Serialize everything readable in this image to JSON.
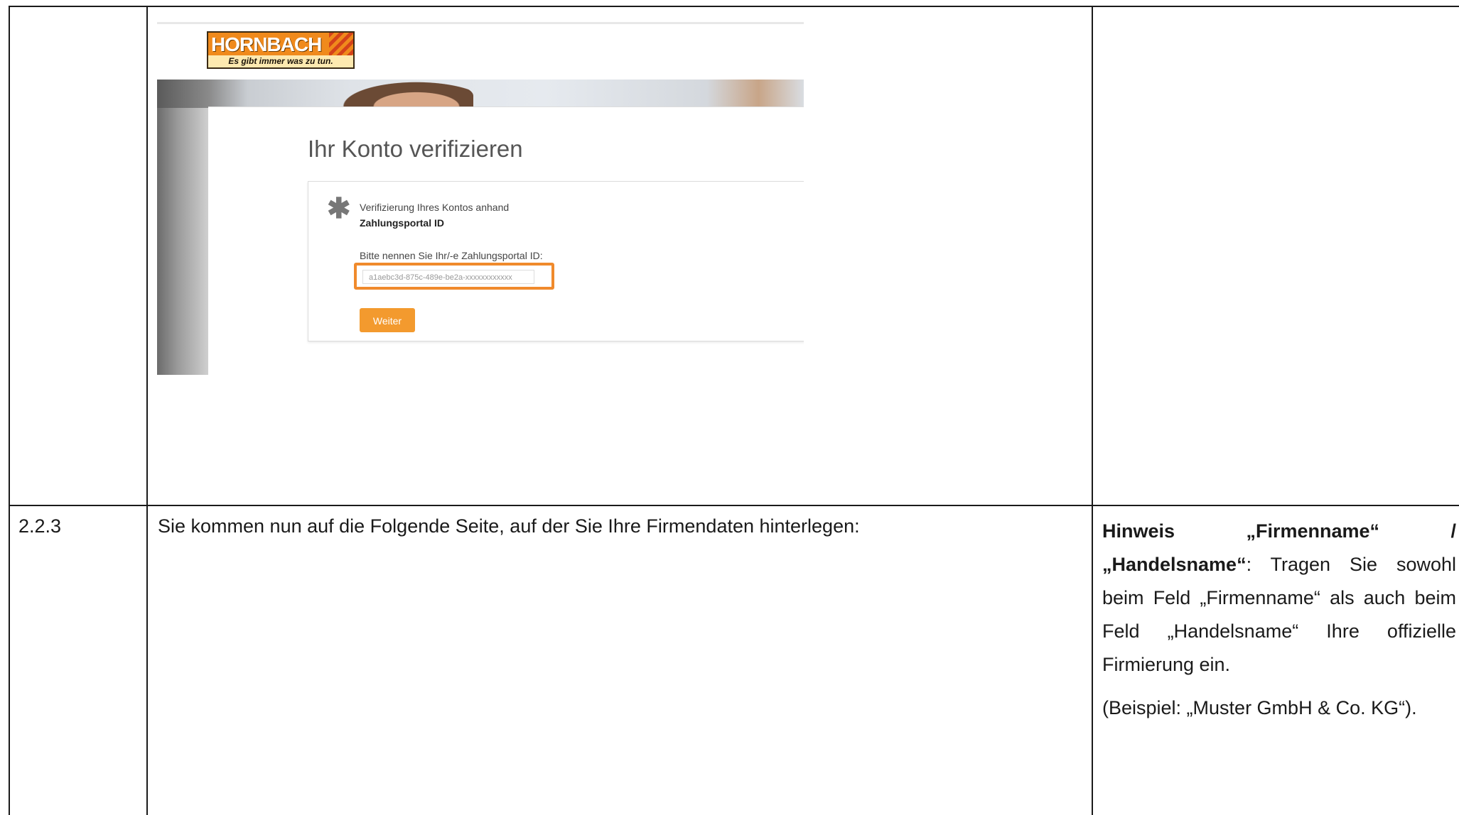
{
  "screenshot": {
    "logo": {
      "brand": "HORNBACH",
      "slogan": "Es gibt immer was zu tun."
    },
    "title": "Ihr Konto verifizieren",
    "verification_line1": "Verifizierung Ihres Kontos anhand",
    "verification_line2": "Zahlungsportal ID",
    "prompt": "Bitte nennen Sie Ihr/-e Zahlungsportal ID:",
    "input_value": "a1aebc3d-875c-489e-be2a-xxxxxxxxxxxx",
    "button_label": "Weiter",
    "accent_color": "#f08a2c"
  },
  "row_2_2_3": {
    "number": "2.2.3",
    "text": "Sie kommen nun auf die Folgende Seite, auf der Sie Ihre Firmendaten hinterlegen:",
    "hint_bold": "Hinweis „Firmenname“ / „Handelsname“",
    "hint_rest": ": Tragen Sie sowohl beim Feld „Firmenname“ als auch beim Feld „Handelsname“ Ihre offizielle Firmierung ein.",
    "example": "(Beispiel: „Muster GmbH & Co. KG“)."
  }
}
